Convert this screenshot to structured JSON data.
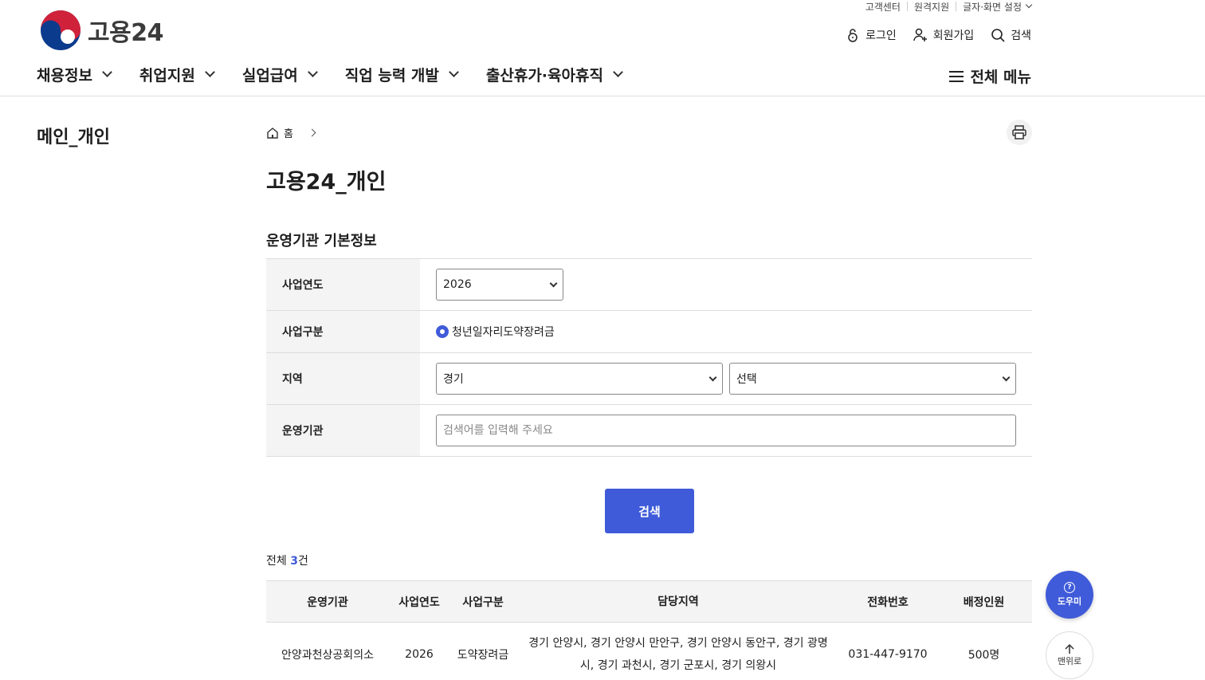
{
  "header": {
    "logo_text": "고용24",
    "utility": [
      "고객센터",
      "원격지원",
      "글자·화면 설정"
    ],
    "auth": {
      "login": "로그인",
      "signup": "회원가입",
      "search": "검색"
    },
    "gnb": [
      "채용정보",
      "취업지원",
      "실업급여",
      "직업 능력 개발",
      "출산휴가·육아휴직"
    ],
    "all_menu": "전체 메뉴"
  },
  "sidebar": {
    "title": "메인_개인"
  },
  "breadcrumb": {
    "home": "홈"
  },
  "page": {
    "title": "고용24_개인",
    "section_title": "운영기관 기본정보"
  },
  "form": {
    "year": {
      "label": "사업연도",
      "value": "2026"
    },
    "type": {
      "label": "사업구분",
      "value": "청년일자리도약장려금"
    },
    "region": {
      "label": "지역",
      "value1": "경기",
      "value2": "선택"
    },
    "org": {
      "label": "운영기관",
      "placeholder": "검색어를 입력해 주세요"
    },
    "search_button": "검색"
  },
  "results": {
    "count_prefix": "전체 ",
    "count": "3",
    "count_suffix": "건",
    "headers": [
      "운영기관",
      "사업연도",
      "사업구분",
      "담당지역",
      "전화번호",
      "배정인원"
    ],
    "rows": [
      {
        "org": "안양과천상공회의소",
        "year": "2026",
        "type": "도약장려금",
        "area": "경기 안양시, 경기 안양시 만안구, 경기 안양시 동안구, 경기 광명시, 경기 과천시, 경기 군포시, 경기 의왕시",
        "phone": "031-447-9170",
        "quota": "500명"
      }
    ]
  },
  "floating": {
    "help": "도우미",
    "top": "맨위로"
  },
  "colors": {
    "accent": "#3f5bd9"
  }
}
